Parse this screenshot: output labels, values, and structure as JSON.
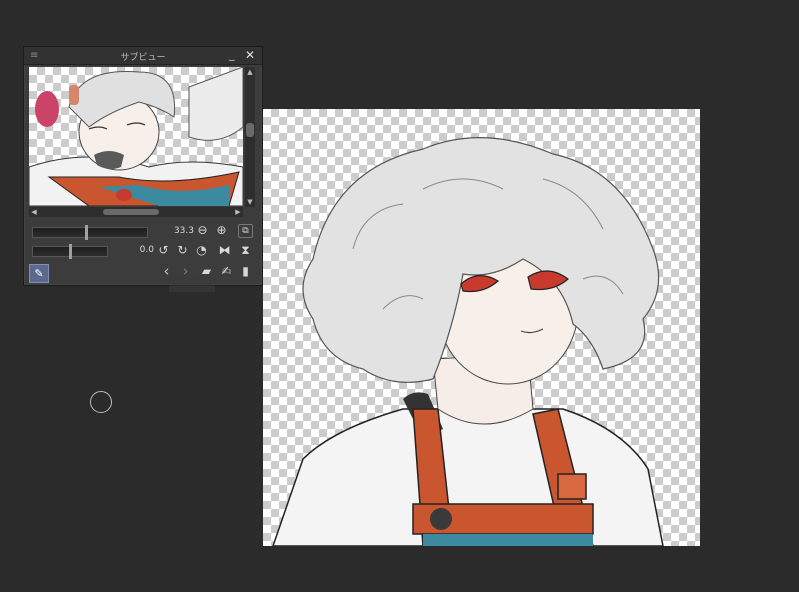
{
  "subview": {
    "title": "サブビュー",
    "menu_icon": "menu-icon",
    "minimize_icon": "minimize-icon",
    "close_icon": "close-icon",
    "zoom_value": "33.3",
    "rotation_value": "0.0",
    "icons": {
      "zoom_out": "zoom-out-icon",
      "zoom_in": "zoom-in-icon",
      "fit": "fit-icon",
      "rotate_ccw": "rotate-left-icon",
      "rotate_cw": "rotate-right-icon",
      "rotate_reset": "rotate-reset-icon",
      "flip_h": "flip-horizontal-icon",
      "flip_v": "flip-vertical-icon",
      "prev": "chevron-left-icon",
      "next": "chevron-right-icon",
      "open": "folder-open-icon",
      "edit": "edit-icon",
      "delete": "trash-icon",
      "eyedropper": "eyedropper-icon"
    }
  },
  "colors": {
    "background": "#2b2b2b",
    "palette": "#3c3c3c",
    "apron_orange": "#c9562e",
    "shirt_blue": "#3b8aa0",
    "eye_red": "#c93a2e",
    "active_tool": "#5b6a8c"
  }
}
